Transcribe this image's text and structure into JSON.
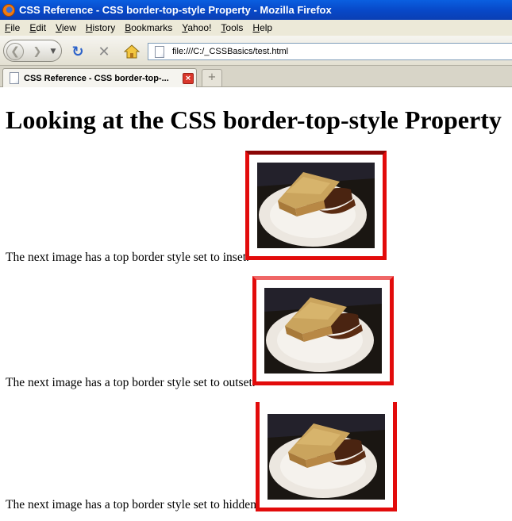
{
  "window": {
    "title": "CSS Reference - CSS border-top-style Property - Mozilla Firefox",
    "icon": "firefox-icon"
  },
  "menu": [
    "File",
    "Edit",
    "View",
    "History",
    "Bookmarks",
    "Yahoo!",
    "Tools",
    "Help"
  ],
  "toolbar": {
    "url": "file:///C:/_CSSBasics/test.html"
  },
  "tabs": [
    {
      "label": "CSS Reference - CSS border-top-..."
    }
  ],
  "page": {
    "heading": "Looking at the CSS border-top-style Property",
    "items": [
      {
        "caption": "The next image has a top border style set to inset.",
        "border_top_style": "inset"
      },
      {
        "caption": "The next image has a top border style set to outset.",
        "border_top_style": "outset"
      },
      {
        "caption": "The next image has a top border style set to hidden.",
        "border_top_style": "hidden"
      }
    ]
  },
  "colors": {
    "border": "#e20b0b",
    "titlebar": "#0a5fe0"
  }
}
